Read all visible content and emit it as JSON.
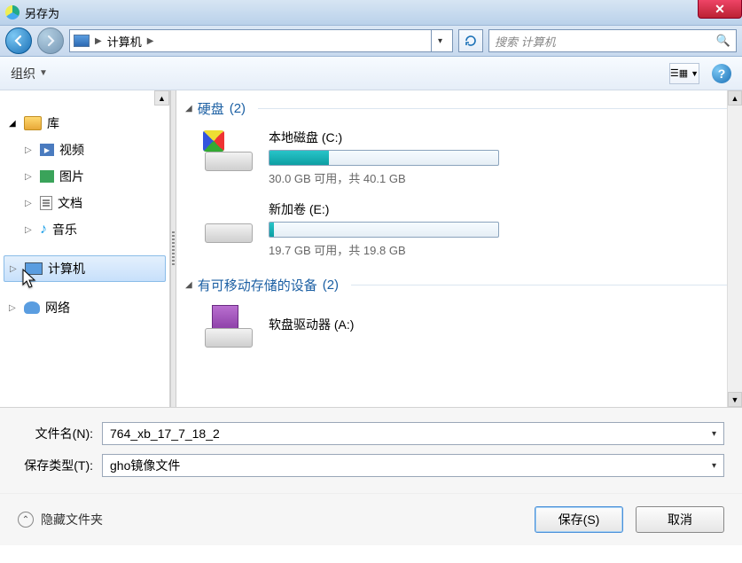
{
  "window": {
    "title": "另存为"
  },
  "nav": {
    "breadcrumb_root": "计算机",
    "search_placeholder": "搜索 计算机"
  },
  "toolbar": {
    "organize": "组织"
  },
  "sidebar": {
    "library": "库",
    "video": "视频",
    "pictures": "图片",
    "documents": "文档",
    "music": "音乐",
    "computer": "计算机",
    "network": "网络"
  },
  "groups": {
    "hard_drives": {
      "label": "硬盘",
      "count": "(2)"
    },
    "removable": {
      "label": "有可移动存储的设备",
      "count": "(2)"
    }
  },
  "drives": {
    "c": {
      "title": "本地磁盘 (C:)",
      "sub": "30.0 GB 可用，共 40.1 GB",
      "fill_pct": 26
    },
    "e": {
      "title": "新加卷 (E:)",
      "sub": "19.7 GB 可用，共 19.8 GB",
      "fill_pct": 2
    },
    "a": {
      "title": "软盘驱动器 (A:)"
    }
  },
  "bottom": {
    "filename_label": "文件名(N):",
    "filename_value": "764_xb_17_7_18_2",
    "type_label": "保存类型(T):",
    "type_value": "gho镜像文件"
  },
  "footer": {
    "hide_folders": "隐藏文件夹",
    "save": "保存(S)",
    "cancel": "取消"
  }
}
